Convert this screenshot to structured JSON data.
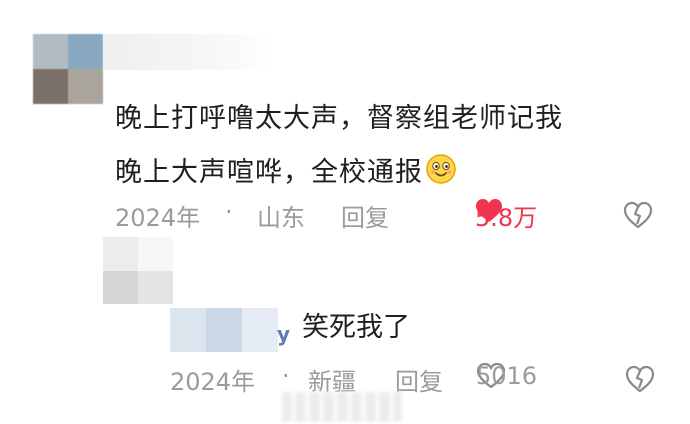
{
  "comment": {
    "lines": [
      "晚上打呼噜太大声，督察组老师记我",
      "晚上大声喧哗，全校通报"
    ],
    "emoji_name": "smile-emoji",
    "year": "2024年",
    "dot": "·",
    "location": "山东",
    "reply_label": "回复",
    "like_count": "5.8万",
    "liked": true
  },
  "reply": {
    "name_suffix": "y",
    "text": "笑死我了",
    "year": "2024年",
    "dot": "·",
    "location": "新疆",
    "reply_label": "回复",
    "like_count": "5016",
    "liked": false
  },
  "colors": {
    "accent_red": "#f0334f",
    "meta_gray": "#9b9b9b",
    "text": "#1f1f1f"
  }
}
